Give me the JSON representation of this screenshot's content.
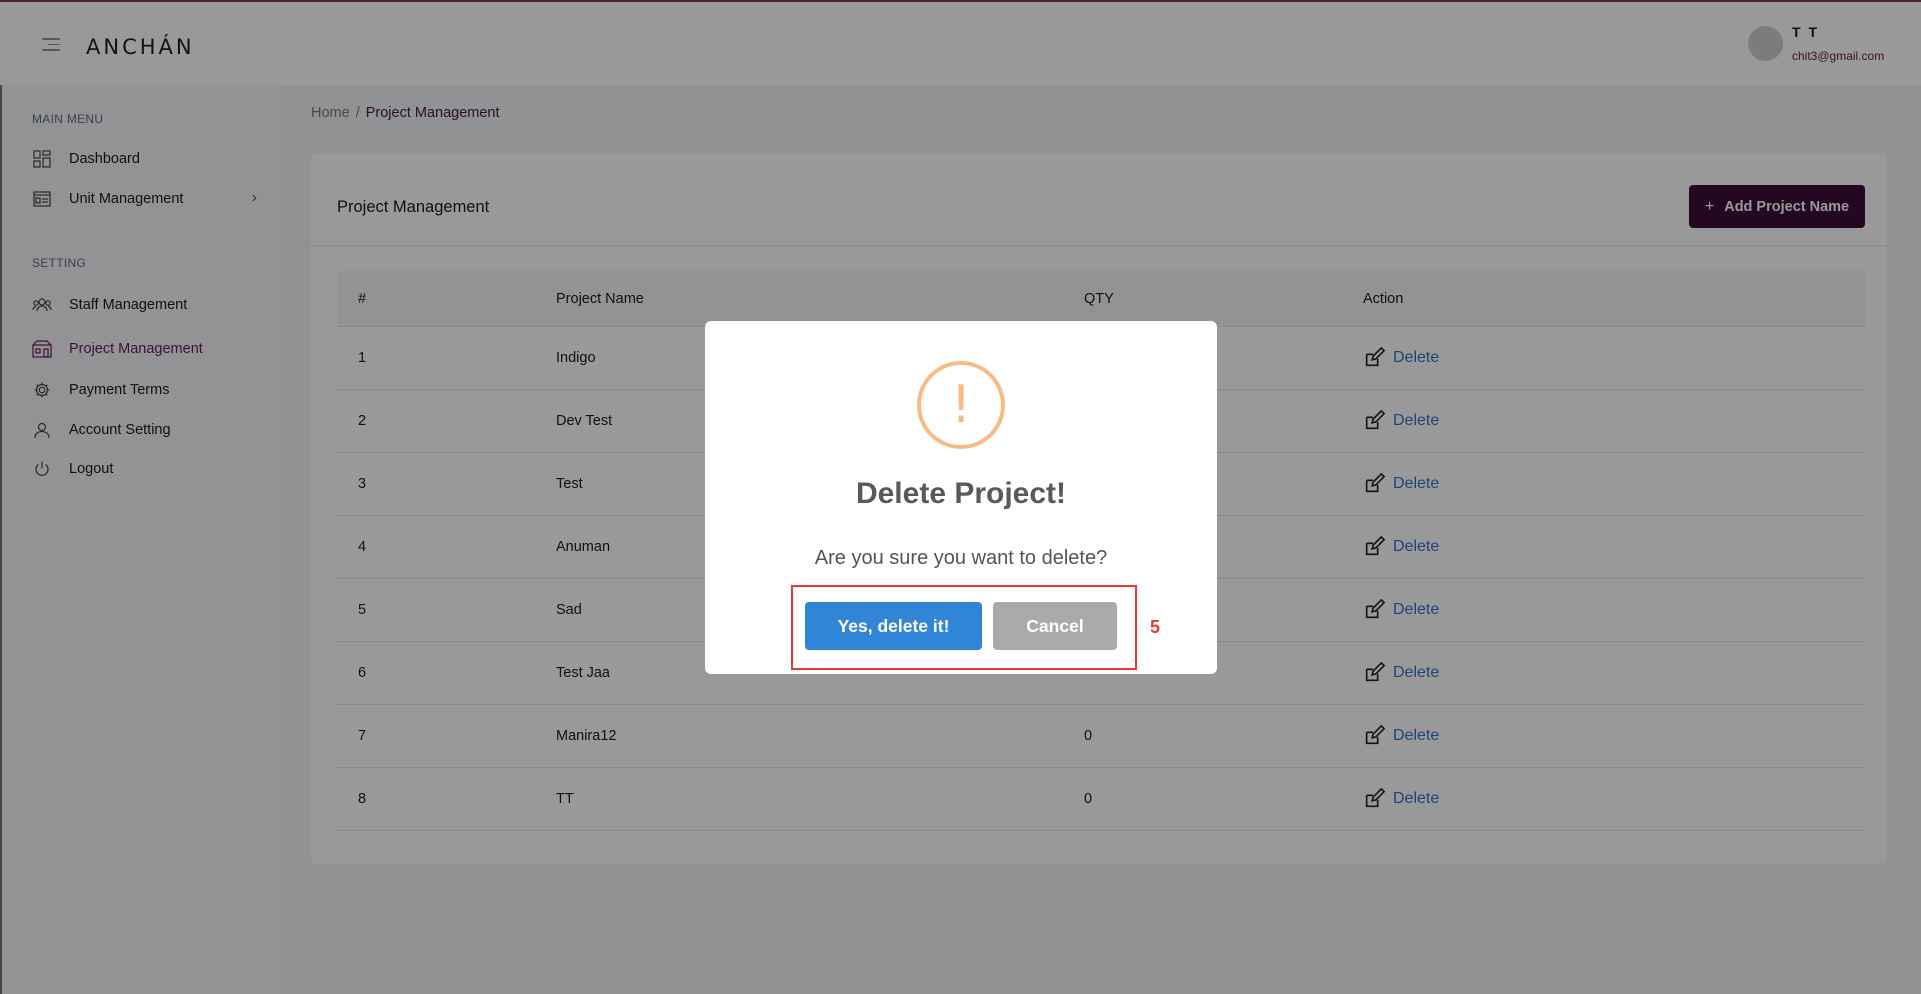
{
  "header": {
    "logo": "ANCHÁN",
    "user_name": "T T",
    "user_email": "chit3@gmail.com"
  },
  "sidebar": {
    "main_menu_title": "MAIN MENU",
    "setting_title": "SETTING",
    "items": [
      {
        "label": "Dashboard",
        "icon": "dashboard-icon"
      },
      {
        "label": "Unit Management",
        "icon": "unit-icon"
      },
      {
        "label": "Staff Management",
        "icon": "staff-icon"
      },
      {
        "label": "Project Management",
        "icon": "project-icon",
        "active": true
      },
      {
        "label": "Payment Terms",
        "icon": "gear-icon"
      },
      {
        "label": "Account Setting",
        "icon": "user-icon"
      },
      {
        "label": "Logout",
        "icon": "power-icon"
      }
    ]
  },
  "breadcrumb": {
    "home": "Home",
    "separator": "/",
    "current": "Project Management"
  },
  "main": {
    "title": "Project Management",
    "add_button": "Add Project Name",
    "table": {
      "headers": [
        "#",
        "Project Name",
        "QTY",
        "Action"
      ],
      "delete_label": "Delete",
      "rows": [
        {
          "num": "1",
          "name": "Indigo",
          "qty": ""
        },
        {
          "num": "2",
          "name": "Dev Test",
          "qty": ""
        },
        {
          "num": "3",
          "name": "Test",
          "qty": ""
        },
        {
          "num": "4",
          "name": "Anuman",
          "qty": ""
        },
        {
          "num": "5",
          "name": "Sad",
          "qty": ""
        },
        {
          "num": "6",
          "name": "Test Jaa",
          "qty": ""
        },
        {
          "num": "7",
          "name": "Manira12",
          "qty": "0"
        },
        {
          "num": "8",
          "name": "TT",
          "qty": "0"
        }
      ]
    }
  },
  "modal": {
    "icon": "!",
    "title": "Delete Project!",
    "text": "Are you sure you want to delete?",
    "confirm": "Yes, delete it!",
    "cancel": "Cancel"
  },
  "annotation": {
    "label": "5",
    "color": "#e53935"
  },
  "colors": {
    "brand": "#3d0d37",
    "active_nav": "#6b1c5c",
    "confirm_button": "#3085d6",
    "cancel_button": "#aaaaaa",
    "warning": "#f8bb86",
    "link": "#2f75c7"
  }
}
